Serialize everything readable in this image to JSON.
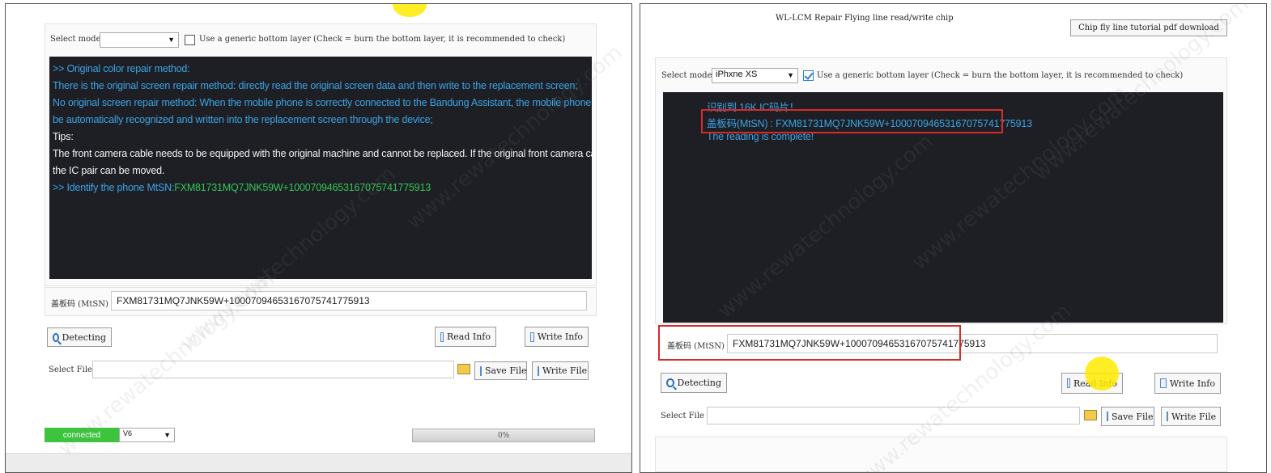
{
  "left": {
    "select_model_label": "Select model:",
    "model_value": "",
    "generic_bottom_label": "Use a generic bottom layer (Check = burn the bottom layer, it is recommended to check)",
    "console_lines": [
      {
        "text": ">> Original color repair method:",
        "color": "blue"
      },
      {
        "text": "There is the original screen repair method: directly read the original screen data and then write to the replacement screen;",
        "color": "blue"
      },
      {
        "text": "No original screen repair method: When the mobile phone is correctly connected to the Bandung Assistant, the mobile phone cover code can",
        "color": "blue"
      },
      {
        "text": "be automatically recognized and written into the replacement screen through the device;",
        "color": "blue"
      },
      {
        "text": "Tips:",
        "color": "white"
      },
      {
        "text": "The front camera cable needs to be equipped with the original machine and cannot be replaced. If the original front camera cable is broken,",
        "color": "white"
      },
      {
        "text": "the IC pair can be moved.",
        "color": "white"
      },
      {
        "text_prefix": " >> Identify the phone MtSN:",
        "text_value": "FXM81731MQ7JNK59W+1000709465316707574177591З",
        "color": "mixed"
      }
    ],
    "mtsn_label": "盖板码 (MtSN)",
    "mtsn_value": "FXM81731MQ7JNK59W+10007094653167075741775913",
    "detecting_label": "Detecting",
    "read_info_label": "Read Info",
    "write_info_label": "Write Info",
    "select_file_label": "Select File",
    "save_file_label": "Save File",
    "write_file_label": "Write File",
    "status_label": "connected",
    "version_value": "V6",
    "progress_text": "0%",
    "progress_fraction": 0
  },
  "right": {
    "title": "WL-LCM Repair Flying line read/write chip",
    "tutorial_button_label": "Chip fly line tutorial pdf download",
    "select_model_label": "Select model:",
    "model_value": "iPhxne XS",
    "generic_bottom_label": "Use a generic bottom layer (Check = burn the bottom layer, it is recommended to check)",
    "console_lines": [
      {
        "text": "识别到 16K IC码片！",
        "color": "blue"
      },
      {
        "text": "盖板码(MtSN) : FXM81731MQ7JNK59W+10007094653167075741775913",
        "color": "blue"
      },
      {
        "text": "The reading is complete!",
        "color": "blue"
      }
    ],
    "mtsn_label": "盖板码 (MtSN)",
    "mtsn_value": "FXM81731MQ7JNK59W+10007094653167075741775913",
    "detecting_label": "Detecting",
    "read_info_label": "Read Info",
    "write_info_label": "Write Info",
    "select_file_label": "Select File",
    "save_file_label": "Save File",
    "write_file_label": "Write File"
  },
  "watermark_text": "www.rewatechnology.com",
  "colors": {
    "console_bg": "#1e1f24",
    "console_blue": "#3ba4e6",
    "console_green": "#34c759",
    "highlight_red": "#d62b2b",
    "status_green": "#3dc43d"
  }
}
